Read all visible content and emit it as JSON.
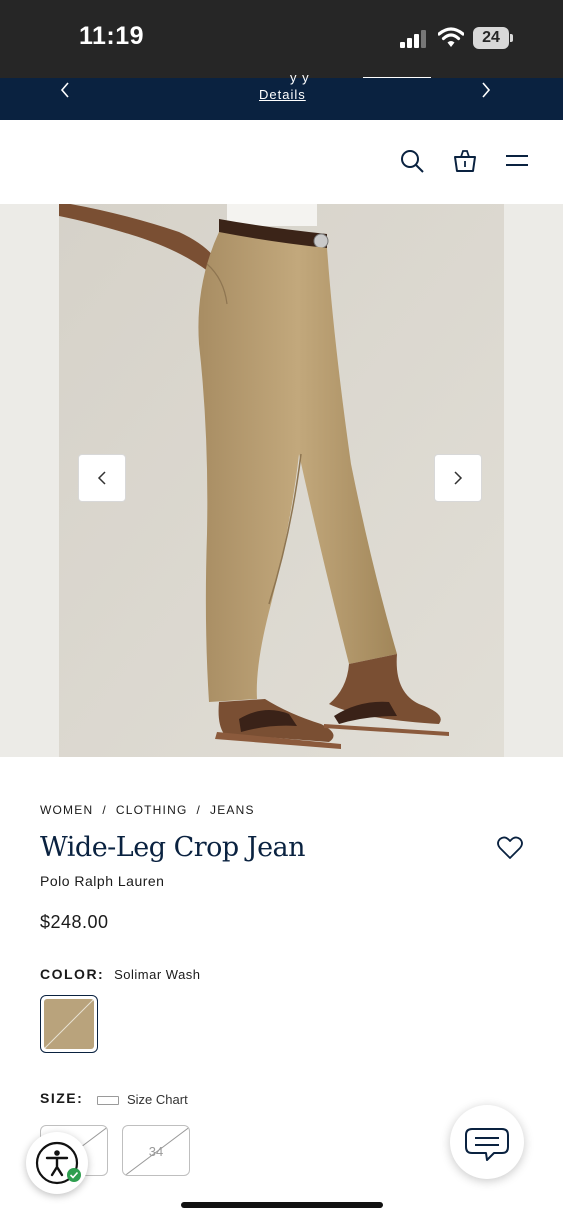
{
  "status_bar": {
    "time": "11:19",
    "battery": "24"
  },
  "promo": {
    "details_link": "Details"
  },
  "product": {
    "breadcrumb": [
      "WOMEN",
      "CLOTHING",
      "JEANS"
    ],
    "breadcrumb_separator": "/",
    "title": "Wide-Leg Crop Jean",
    "brand": "Polo Ralph Lauren",
    "price": "$248.00",
    "color_label": "COLOR:",
    "color_value": "Solimar Wash",
    "size_label": "SIZE:",
    "size_chart_label": "Size Chart",
    "sizes": [
      "32",
      "34"
    ]
  },
  "icons": {
    "search": "search-icon",
    "bag": "shopping-bag-icon",
    "menu": "hamburger-menu-icon",
    "wishlist": "heart-icon",
    "prev": "chevron-left-icon",
    "next": "chevron-right-icon",
    "accessibility": "accessibility-icon",
    "chat": "chat-icon"
  },
  "colors": {
    "navy": "#0a2240",
    "status_bar": "#262626",
    "swatch": "#b9a37c"
  }
}
